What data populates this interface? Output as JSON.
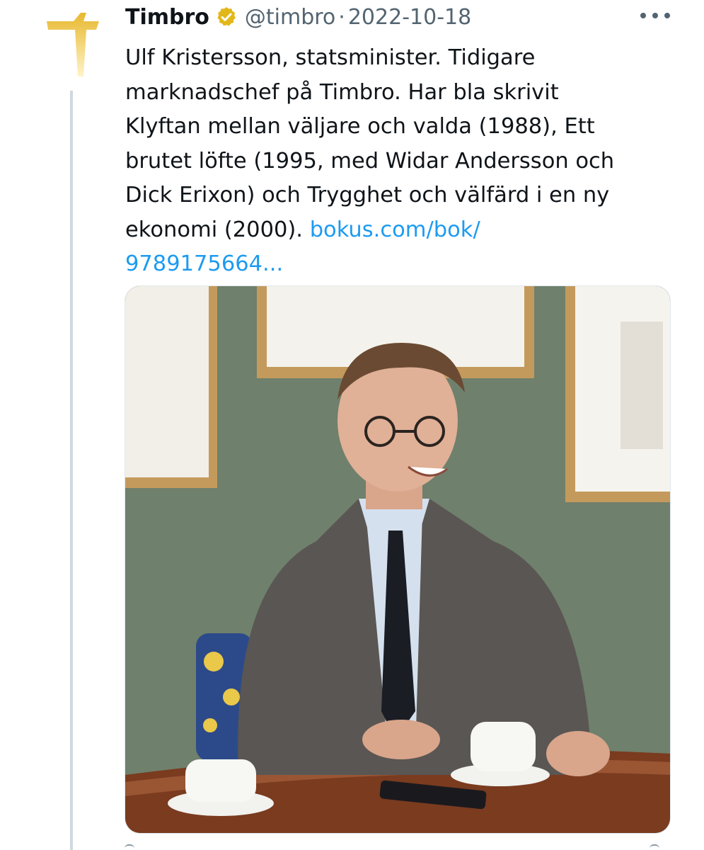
{
  "author": {
    "display_name": "Timbro",
    "handle": "@timbro",
    "separator": "·",
    "date": "2022-10-18",
    "avatar_icon": "timbro-logo-icon",
    "verified_icon": "verified-badge-icon",
    "verified_color": "#e2b719"
  },
  "tweet": {
    "lines": [
      "Ulf Kristersson, statsminister. Tidigare",
      "marknadschef på Timbro. Har bla skrivit",
      "Klyftan mellan väljare och valda (1988), Ett",
      "brutet löfte (1995, med Widar Andersson och",
      "Dick Erixon) och Trygghet och välfärd i en ny"
    ],
    "last_line_text": "ekonomi (2000). ",
    "link_part1": "bokus.com/bok/",
    "link_part2": "9789175664..."
  },
  "media": {
    "type": "photo",
    "description_icon": "portrait-photo"
  },
  "colors": {
    "link": "#1d9bf0",
    "muted": "#536471",
    "text": "#0f1419",
    "brand": "#e8b92f"
  }
}
